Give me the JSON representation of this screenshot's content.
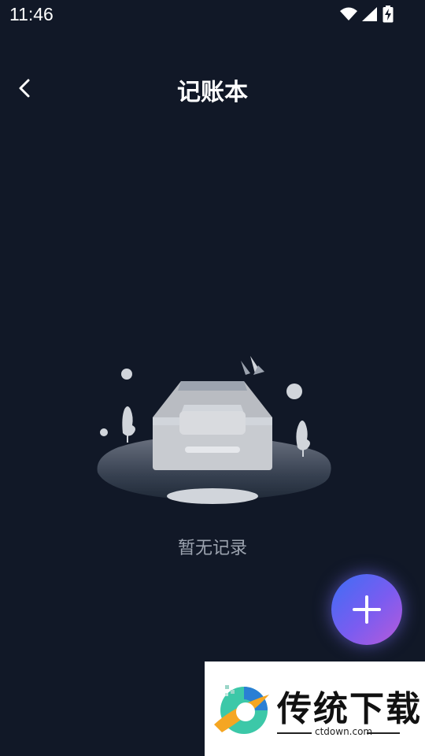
{
  "status_bar": {
    "time": "11:46",
    "icons": [
      "wifi-icon",
      "signal-icon",
      "battery-charging-icon"
    ]
  },
  "header": {
    "title": "记账本",
    "back_icon": "chevron-left-icon"
  },
  "empty_state": {
    "message": "暂无记录",
    "illustration": "empty-inbox-icon"
  },
  "fab": {
    "icon": "plus-icon"
  },
  "watermark": {
    "brand": "传统下载",
    "domain": "ctdown.com"
  },
  "colors": {
    "background": "#111827",
    "text_secondary": "#9ca3af",
    "fab_gradient_start": "#3d6ef5",
    "fab_gradient_end": "#b85ad9"
  }
}
